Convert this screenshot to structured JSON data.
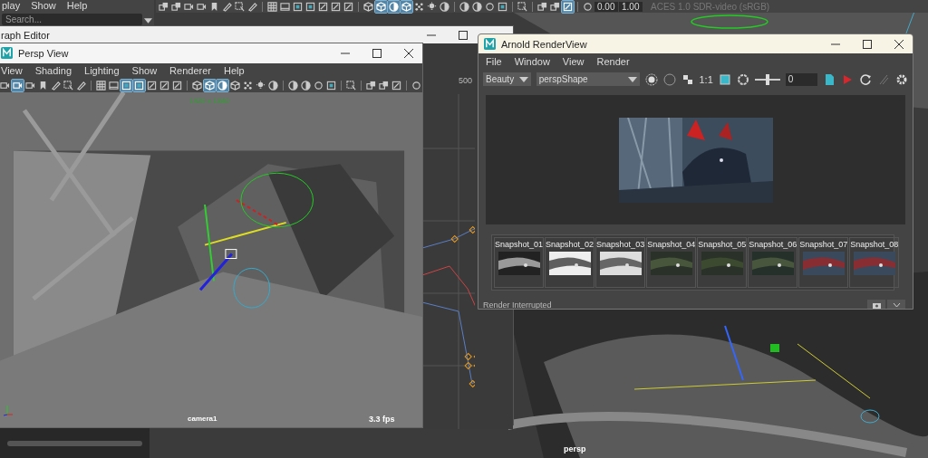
{
  "outliner": {
    "menus": [
      "play",
      "Show",
      "Help"
    ],
    "search": {
      "placeholder": "Search..."
    }
  },
  "status_line": {
    "tools": [
      {
        "kind": "layers",
        "on": false
      },
      {
        "kind": "layers",
        "on": false
      },
      {
        "kind": "camera",
        "on": false
      },
      {
        "kind": "camera",
        "on": false
      },
      {
        "kind": "bookmark",
        "on": false
      },
      {
        "kind": "pencil",
        "on": false
      },
      {
        "kind": "select",
        "on": false
      },
      {
        "kind": "pencil",
        "on": false
      },
      {
        "kind": "sep"
      },
      {
        "kind": "grid",
        "on": false
      },
      {
        "kind": "film",
        "on": false
      },
      {
        "kind": "square",
        "on": false
      },
      {
        "kind": "square",
        "on": false
      },
      {
        "kind": "frame",
        "on": false
      },
      {
        "kind": "frame",
        "on": false
      },
      {
        "kind": "frame",
        "on": false
      },
      {
        "kind": "sep"
      },
      {
        "kind": "cube",
        "on": false
      },
      {
        "kind": "cube",
        "on": true
      },
      {
        "kind": "sphere",
        "on": true
      },
      {
        "kind": "cube",
        "on": true
      },
      {
        "kind": "dots",
        "on": false
      },
      {
        "kind": "light",
        "on": false
      },
      {
        "kind": "sphere",
        "on": false
      },
      {
        "kind": "sep"
      },
      {
        "kind": "sphere",
        "on": false
      },
      {
        "kind": "sphere",
        "on": false
      },
      {
        "kind": "ring",
        "on": false
      },
      {
        "kind": "square",
        "on": false
      },
      {
        "kind": "sep"
      },
      {
        "kind": "select",
        "on": false
      },
      {
        "kind": "sep"
      },
      {
        "kind": "layers",
        "on": false
      },
      {
        "kind": "layers",
        "on": false
      },
      {
        "kind": "frame",
        "on": true
      },
      {
        "kind": "sep"
      },
      {
        "kind": "ring",
        "on": false
      }
    ],
    "gain": "0.00",
    "gamma": "1.00",
    "color_space": "ACES 1.0 SDR-video (sRGB)"
  },
  "graph_editor": {
    "title": "raph Editor",
    "ticks": [
      "500"
    ]
  },
  "persp_view": {
    "title": "Persp View",
    "menus": [
      "View",
      "Shading",
      "Lighting",
      "Show",
      "Renderer",
      "Help"
    ],
    "tools": [
      {
        "kind": "camera",
        "on": false
      },
      {
        "kind": "camera",
        "on": true
      },
      {
        "kind": "camera",
        "on": false
      },
      {
        "kind": "bookmark",
        "on": false
      },
      {
        "kind": "pencil",
        "on": false
      },
      {
        "kind": "select",
        "on": false
      },
      {
        "kind": "pencil",
        "on": false
      },
      {
        "kind": "sep"
      },
      {
        "kind": "grid",
        "on": false
      },
      {
        "kind": "film",
        "on": false
      },
      {
        "kind": "square",
        "on": true
      },
      {
        "kind": "square",
        "on": true
      },
      {
        "kind": "frame",
        "on": false
      },
      {
        "kind": "frame",
        "on": false
      },
      {
        "kind": "frame",
        "on": false
      },
      {
        "kind": "sep"
      },
      {
        "kind": "cube",
        "on": false
      },
      {
        "kind": "cube",
        "on": true
      },
      {
        "kind": "sphere",
        "on": true
      },
      {
        "kind": "cube",
        "on": false
      },
      {
        "kind": "dots",
        "on": false
      },
      {
        "kind": "light",
        "on": false
      },
      {
        "kind": "sphere",
        "on": false
      },
      {
        "kind": "sep"
      },
      {
        "kind": "sphere",
        "on": false
      },
      {
        "kind": "sphere",
        "on": false
      },
      {
        "kind": "ring",
        "on": false
      },
      {
        "kind": "square",
        "on": false
      },
      {
        "kind": "sep"
      },
      {
        "kind": "select",
        "on": false
      },
      {
        "kind": "sep"
      },
      {
        "kind": "layers",
        "on": false
      },
      {
        "kind": "layers",
        "on": false
      },
      {
        "kind": "frame",
        "on": false
      },
      {
        "kind": "sep"
      },
      {
        "kind": "ring",
        "on": false
      }
    ],
    "resolution": "1920 x 1080",
    "camera": "camera1",
    "fps": "3.3 fps"
  },
  "render_view": {
    "title": "Arnold RenderView",
    "menus": [
      "File",
      "Window",
      "View",
      "Render"
    ],
    "aov": "Beauty",
    "camera": "perspShape",
    "ratio": "1:1",
    "exposure": {
      "level": 0.5,
      "value": "0"
    },
    "snapshots": [
      {
        "label": "Snapshot_01"
      },
      {
        "label": "Snapshot_02"
      },
      {
        "label": "Snapshot_03"
      },
      {
        "label": "Snapshot_04"
      },
      {
        "label": "Snapshot_05"
      },
      {
        "label": "Snapshot_06"
      },
      {
        "label": "Snapshot_07"
      },
      {
        "label": "Snapshot_08"
      }
    ],
    "status": "Render Interrupted"
  },
  "main_viewport": {
    "camera": "persp"
  }
}
